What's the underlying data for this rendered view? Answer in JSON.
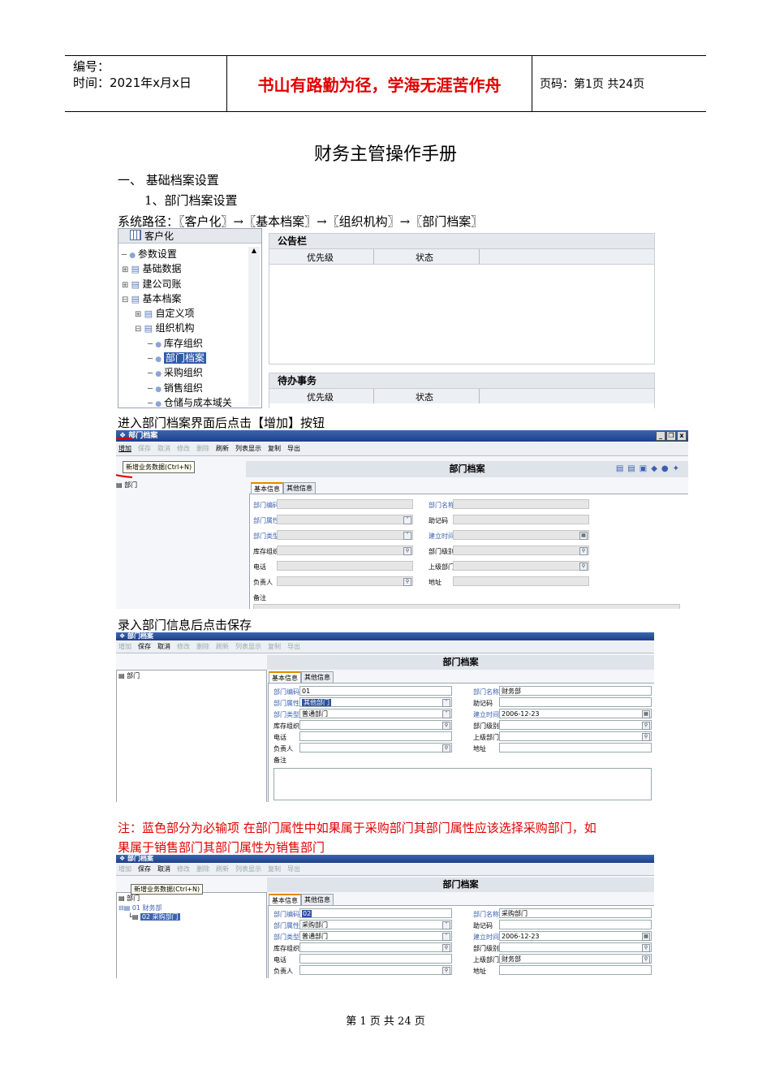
{
  "header": {
    "number_label": "编号：",
    "date_text": "时间：2021年x月x日",
    "motto": "书山有路勤为径，学海无涯苦作舟",
    "page_text": "页码：第1页  共24页"
  },
  "doc": {
    "title": "财务主管操作手册",
    "section1": "一、      基础档案设置",
    "sub1": "1、部门档案设置",
    "path": "系统路径：〖客户化〗→〖基本档案〗→〖组织机构〗→〖部门档案〗",
    "step1": "进入部门档案界面后点击【增加】按钮",
    "step2": "录入部门信息后点击保存",
    "note_line1": "注：蓝色部分为必输项  在部门属性中如果属于采购部门其部门属性应该选择采购部门，如",
    "note_line2": "果属于销售部门其部门属性为销售部门",
    "footer": "第 1 页 共 24 页"
  },
  "nav_shot": {
    "tree_title": "客户化",
    "items": [
      "参数设置",
      "基础数据",
      "建公司账",
      "基本档案",
      "自定义项",
      "组织机构",
      "库存组织",
      "部门档案",
      "采购组织",
      "销售组织",
      "仓储与成本域关"
    ],
    "notice_title": "公告栏",
    "todo_title": "待办事务",
    "col_priority": "优先级",
    "col_status": "状态"
  },
  "dept_window": {
    "title": "部门档案",
    "tools": [
      "增加",
      "保存",
      "取消",
      "修改",
      "删除",
      "刷新",
      "列表显示",
      "复制",
      "导出"
    ],
    "tooltip": "新增业务数据(Ctrl+N)",
    "header": "部门档案",
    "tree_root": "部门",
    "tab_basic": "基本信息",
    "tab_other": "其他信息",
    "labels": {
      "code": "部门编码",
      "name": "部门名称",
      "attr": "部门属性",
      "mnemonic": "助记码",
      "type": "部门类型",
      "created": "建立时间",
      "inv_org": "库存组织",
      "level": "部门级别",
      "phone": "电话",
      "parent": "上级部门",
      "manager": "负责人",
      "address": "地址",
      "remark": "备注"
    }
  },
  "shot2_values": {
    "code": "01",
    "name": "财务部",
    "attr": "其他部门",
    "type": "普通部门",
    "created": "2006-12-23"
  },
  "shot3_values": {
    "tree_node1": "01 财务部",
    "tree_node2": "02 采购部门",
    "code": "02",
    "name": "采购部门",
    "attr": "采购部门",
    "type": "普通部门",
    "created": "2006-12-23",
    "parent": "财务部"
  },
  "colors": {
    "motto": "#e00000",
    "note": "#e00000",
    "required_label": "#3a5fb0",
    "title_bar": "#1e3f88"
  }
}
